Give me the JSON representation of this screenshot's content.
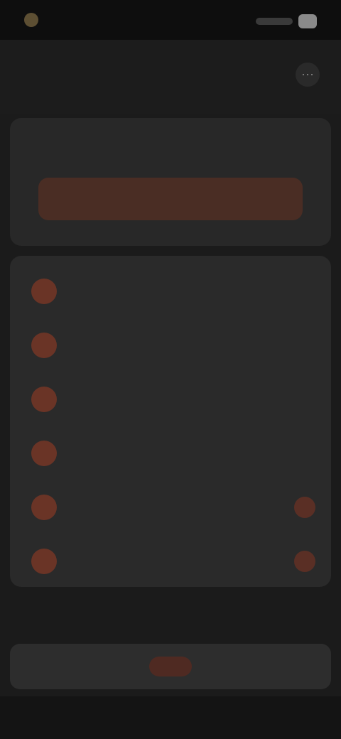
{
  "status_bar": {
    "time": "",
    "right_indicators": [
      "signal",
      "battery"
    ]
  },
  "header": {
    "title": "",
    "action_icon": "more-icon"
  },
  "hero": {
    "title": "",
    "button_label": ""
  },
  "menu": {
    "items": [
      {
        "label": "",
        "icon": "item-icon",
        "badge": ""
      },
      {
        "label": "",
        "icon": "item-icon",
        "badge": ""
      },
      {
        "label": "",
        "icon": "item-icon",
        "badge": ""
      },
      {
        "label": "",
        "icon": "item-icon",
        "badge": ""
      },
      {
        "label": "",
        "icon": "item-icon",
        "badge": ""
      },
      {
        "label": "",
        "icon": "item-icon",
        "badge": ""
      }
    ]
  },
  "footer": {
    "note": "",
    "button_label": ""
  },
  "colors": {
    "background": "#1b1b1b",
    "card": "#2a2a2a",
    "accent": "#e06a52",
    "accent_muted": "#6a3426",
    "text_primary": "#f0f0f0",
    "text_secondary": "#d7d7d7"
  }
}
